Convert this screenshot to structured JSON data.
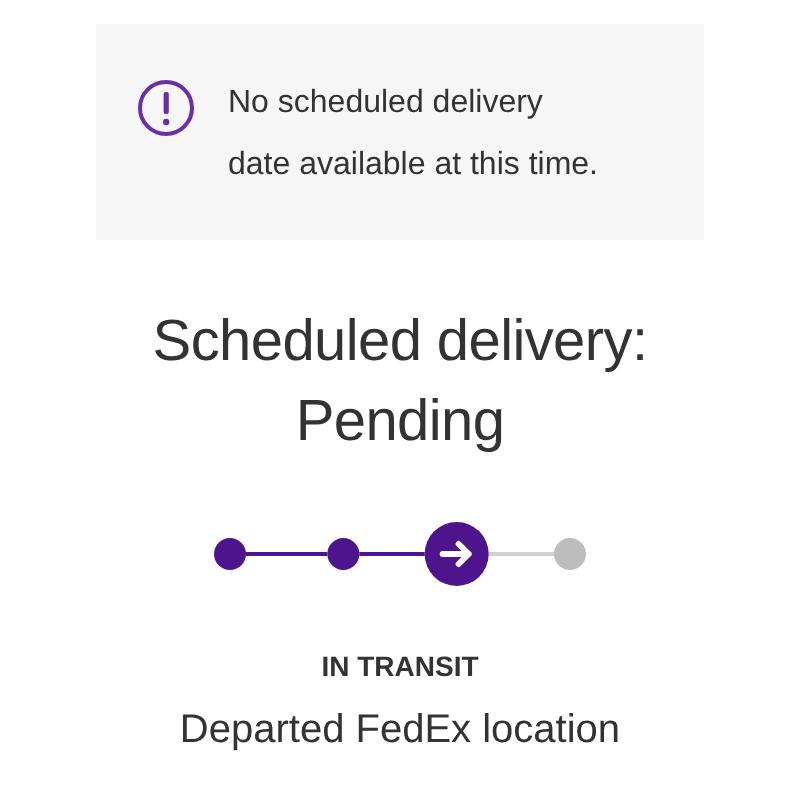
{
  "notice": {
    "text": "No scheduled delivery date available at this time."
  },
  "heading": [
    "Scheduled delivery:",
    "Pending"
  ],
  "progress": [
    {
      "kind": "done"
    },
    {
      "kind": "done"
    },
    {
      "kind": "current"
    },
    {
      "kind": "pending"
    }
  ],
  "status": "IN TRANSIT",
  "detail": "Departed FedEx location"
}
